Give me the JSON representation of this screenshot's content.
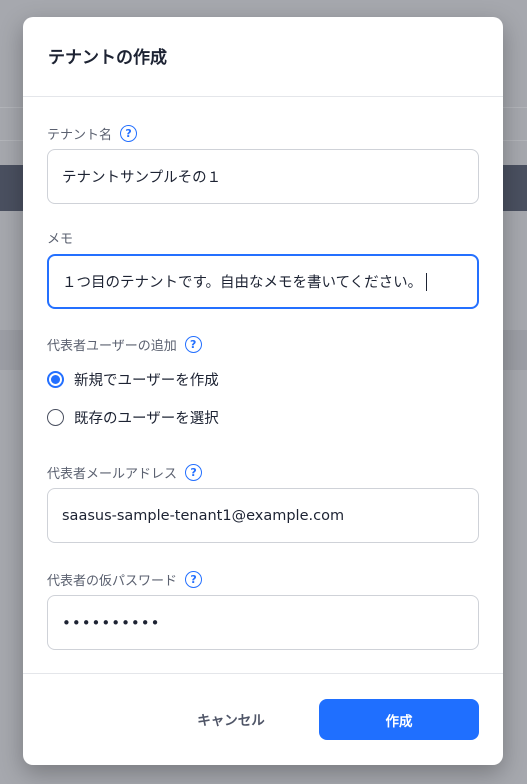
{
  "dialog": {
    "title": "テナントの作成"
  },
  "form": {
    "tenant_name": {
      "label": "テナント名",
      "value": "テナントサンプルその１"
    },
    "memo": {
      "label": "メモ",
      "value": "１つ目のテナントです。自由なメモを書いてください。"
    },
    "representative_user": {
      "label": "代表者ユーザーの追加",
      "options": [
        {
          "label": "新規でユーザーを作成",
          "checked": true
        },
        {
          "label": "既存のユーザーを選択",
          "checked": false
        }
      ]
    },
    "email": {
      "label": "代表者メールアドレス",
      "value": "saasus-sample-tenant1@example.com"
    },
    "password": {
      "label": "代表者の仮パスワード",
      "value": "••••••••••"
    },
    "help_glyph": "?"
  },
  "footer": {
    "cancel_label": "キャンセル",
    "create_label": "作成"
  },
  "colors": {
    "accent": "#1f6fff",
    "title": "#1d2333",
    "label": "#5b6170"
  }
}
